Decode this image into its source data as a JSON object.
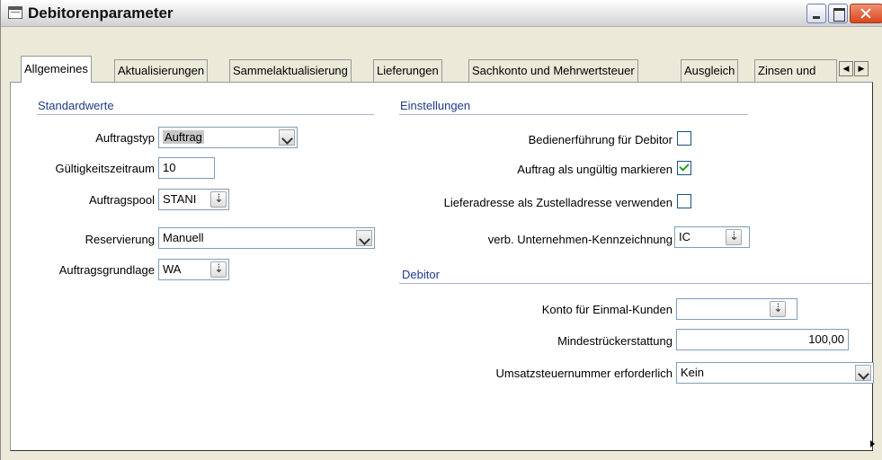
{
  "window": {
    "title": "Debitorenparameter"
  },
  "tabs": [
    {
      "label": "Allgemeines",
      "active": true
    },
    {
      "label": "Aktualisierungen"
    },
    {
      "label": "Sammelaktualisierung"
    },
    {
      "label": "Lieferungen"
    },
    {
      "label": "Sachkonto und Mehrwertsteuer"
    },
    {
      "label": "Ausgleich"
    },
    {
      "label": "Zinsen und"
    }
  ],
  "standardwerte": {
    "title": "Standardwerte",
    "auftragstyp": {
      "label": "Auftragstyp",
      "value": "Auftrag"
    },
    "gueltigkeitszeitraum": {
      "label": "Gültigkeitszeitraum",
      "value": "10"
    },
    "auftragspool": {
      "label": "Auftragspool",
      "value": "STANI"
    },
    "reservierung": {
      "label": "Reservierung",
      "value": "Manuell"
    },
    "auftragsgrundlage": {
      "label": "Auftragsgrundlage",
      "value": "WA"
    }
  },
  "einstellungen": {
    "title": "Einstellungen",
    "bedienerfuehrung": {
      "label": "Bedienerführung für Debitor",
      "checked": false
    },
    "auftrag_ungueltig": {
      "label": "Auftrag als ungültig markieren",
      "checked": true
    },
    "lieferadresse": {
      "label": "Lieferadresse als Zustelladresse verwenden",
      "checked": false
    },
    "kennzeichnung": {
      "label": "verb. Unternehmen-Kennzeichnung",
      "value": "IC"
    }
  },
  "debitor": {
    "title": "Debitor",
    "konto_einmal": {
      "label": "Konto für Einmal-Kunden",
      "value": ""
    },
    "mindestrueck": {
      "label": "Mindestrückerstattung",
      "value": "100,00"
    },
    "umsatzsteuer": {
      "label": "Umsatzsteuernummer erforderlich",
      "value": "Kein"
    }
  },
  "colors": {
    "section_title": "#1f3b86",
    "checkbox_tick": "#21a121",
    "close_button": "#d9461d"
  }
}
